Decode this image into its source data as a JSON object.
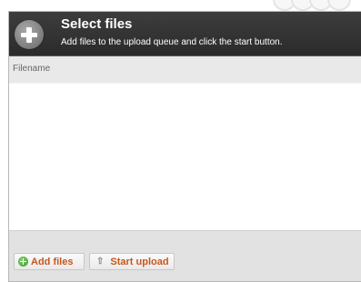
{
  "uploader": {
    "title": "Select files",
    "subtitle": "Add files to the upload queue and click the start button.",
    "header_icon": "plus-circle-icon",
    "columns": {
      "filename": "Filename"
    },
    "files": [],
    "buttons": {
      "add_files": {
        "label": "Add files",
        "icon": "add-green-circle-icon"
      },
      "start_upload": {
        "label": "Start upload",
        "icon": "up-arrow-icon"
      }
    }
  },
  "colors": {
    "header_bg": "#333333",
    "button_text": "#c8561c",
    "column_header_bg": "#e9e9e9",
    "footer_bg": "#e2e2e2"
  }
}
